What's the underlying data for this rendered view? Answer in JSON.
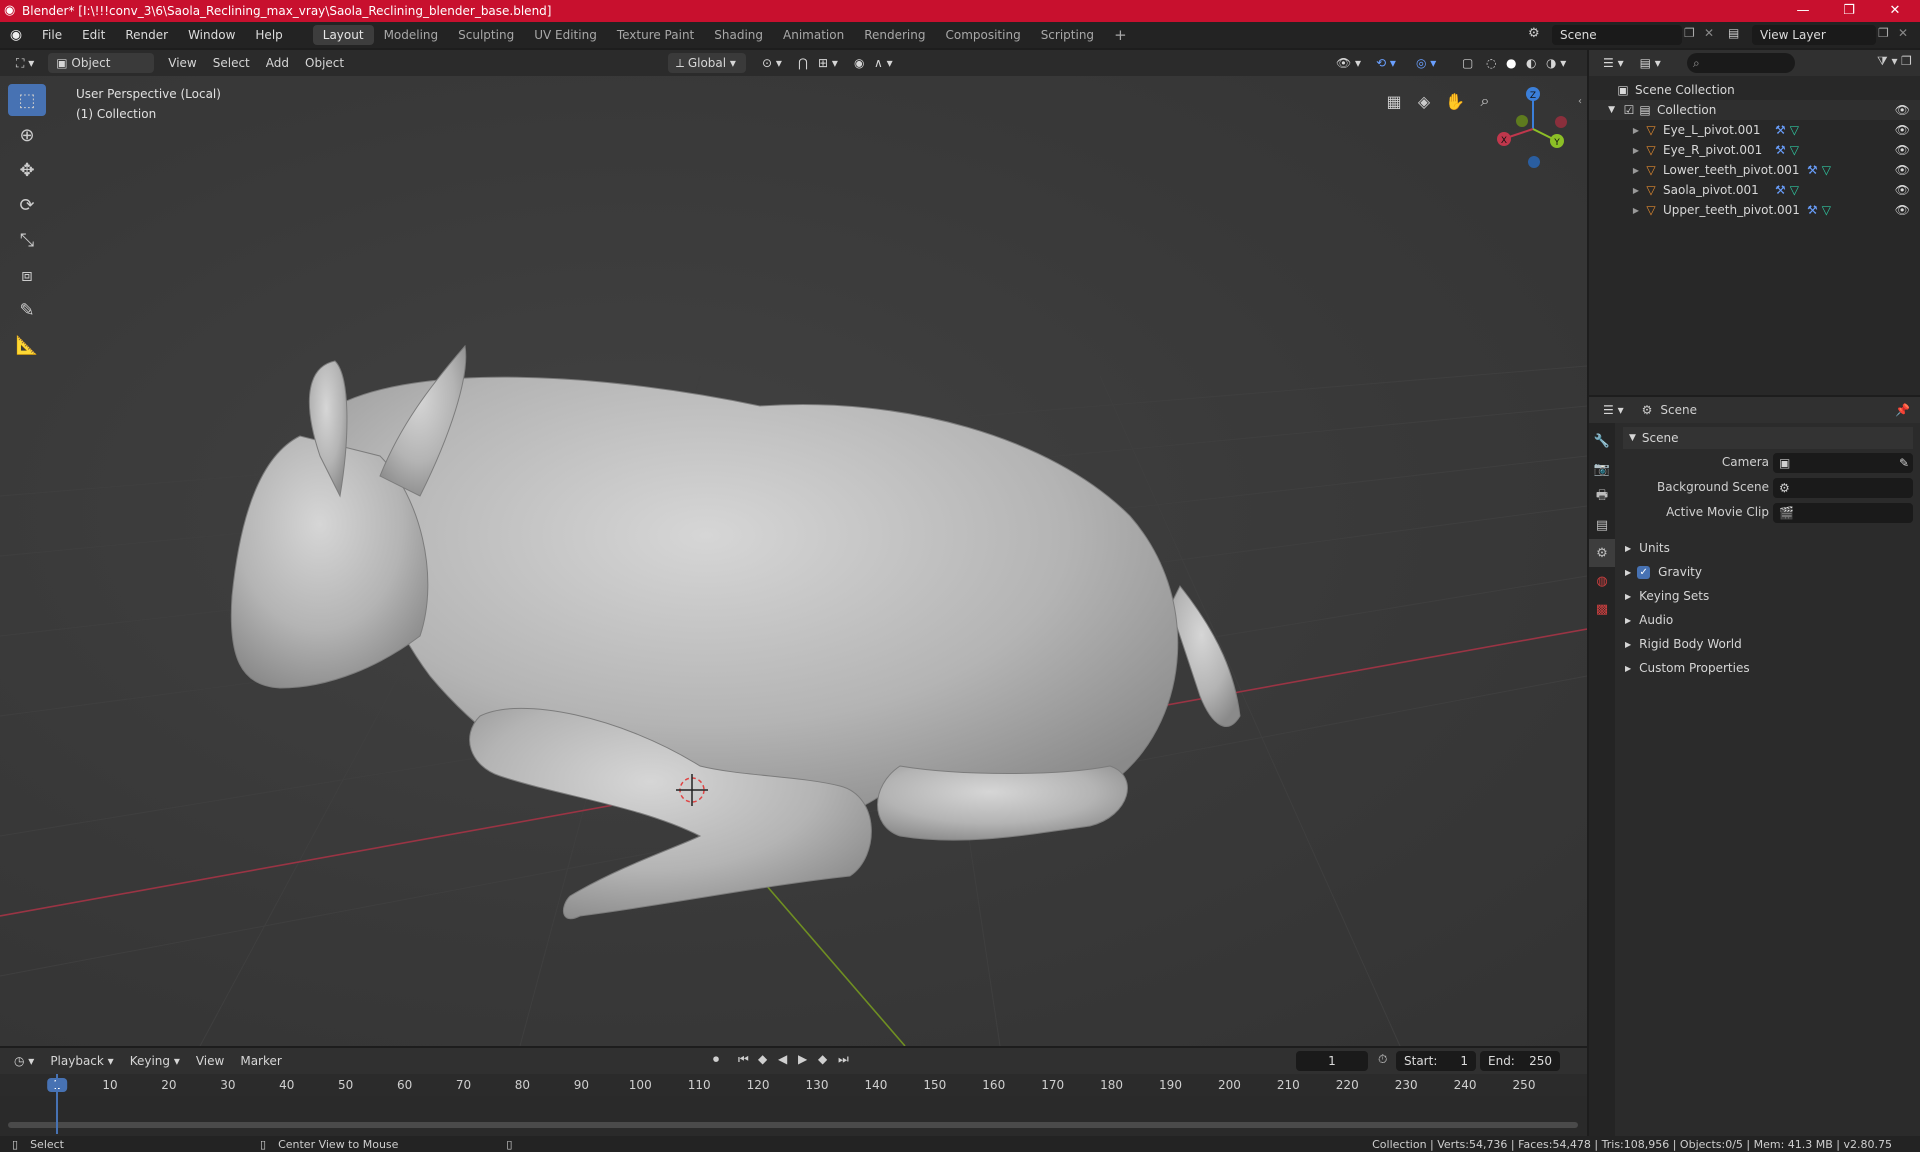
{
  "window": {
    "title": "Blender* [I:\\!!!conv_3\\6\\Saola_Reclining_max_vray\\Saola_Reclining_blender_base.blend]",
    "minimize": "—",
    "maximize": "❐",
    "close": "✕"
  },
  "menu": [
    "File",
    "Edit",
    "Render",
    "Window",
    "Help"
  ],
  "workspaces": [
    "Layout",
    "Modeling",
    "Sculpting",
    "UV Editing",
    "Texture Paint",
    "Shading",
    "Animation",
    "Rendering",
    "Compositing",
    "Scripting"
  ],
  "active_workspace": "Layout",
  "add_workspace": "+",
  "scene_selector": {
    "value": "Scene"
  },
  "view_layer_selector": {
    "value": "View Layer"
  },
  "viewport_header": {
    "mode": "Object Mode",
    "menus": [
      "View",
      "Select",
      "Add",
      "Object"
    ],
    "transform_orientation": "Global"
  },
  "viewport": {
    "perspective_label": "User Perspective (Local)",
    "collection_label": "(1) Collection",
    "gizmo": {
      "x": "X",
      "y": "Y",
      "z": "Z"
    }
  },
  "outliner": {
    "search_placeholder": "",
    "root": "Scene Collection",
    "collection": "Collection",
    "items": [
      {
        "name": "Eye_L_pivot.001"
      },
      {
        "name": "Eye_R_pivot.001"
      },
      {
        "name": "Lower_teeth_pivot.001"
      },
      {
        "name": "Saola_pivot.001"
      },
      {
        "name": "Upper_teeth_pivot.001"
      }
    ]
  },
  "properties": {
    "context": "Scene",
    "panel_title": "Scene",
    "fields": [
      {
        "label": "Camera",
        "value": ""
      },
      {
        "label": "Background Scene",
        "value": ""
      },
      {
        "label": "Active Movie Clip",
        "value": ""
      }
    ],
    "sections": [
      {
        "label": "Units",
        "checkbox": false
      },
      {
        "label": "Gravity",
        "checkbox": true
      },
      {
        "label": "Keying Sets",
        "checkbox": false
      },
      {
        "label": "Audio",
        "checkbox": false
      },
      {
        "label": "Rigid Body World",
        "checkbox": false
      },
      {
        "label": "Custom Properties",
        "checkbox": false
      }
    ]
  },
  "timeline": {
    "menus": [
      "Playback",
      "Keying",
      "View",
      "Marker"
    ],
    "current_frame": "1",
    "start_label": "Start:",
    "start": "1",
    "end_label": "End:",
    "end": "250",
    "ruler": [
      1,
      10,
      20,
      30,
      40,
      50,
      60,
      70,
      80,
      90,
      100,
      110,
      120,
      130,
      140,
      150,
      160,
      170,
      180,
      190,
      200,
      210,
      220,
      230,
      240,
      250
    ]
  },
  "statusbar": {
    "left": "Select",
    "middle": "Center View to Mouse",
    "right": "Collection | Verts:54,736 | Faces:54,478 | Tris:108,956 | Objects:0/5 | Mem: 41.3 MB | v2.80.75"
  },
  "colors": {
    "accent": "#4772b3",
    "titlebar": "#c8102e",
    "x_axis": "#c0374c",
    "y_axis": "#8cbf26",
    "z_axis": "#3b7fd9",
    "object_icon": "#e0892f",
    "mesh_icon": "#2fc7a0"
  }
}
